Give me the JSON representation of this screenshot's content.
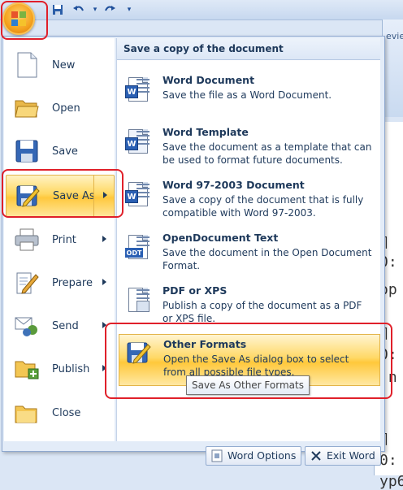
{
  "window": {
    "ribbon_tab_fragment": "evie"
  },
  "document": {
    "lines": [
      "¶",
      "0:",
      "op",
      "¶",
      "0:",
      "·n",
      "¶",
      "0:",
      "yp6"
    ]
  },
  "menu": {
    "left_items": [
      {
        "label": "New",
        "icon": "new-document-icon"
      },
      {
        "label": "Open",
        "icon": "open-folder-icon"
      },
      {
        "label": "Save",
        "icon": "save-disk-icon"
      },
      {
        "label": "Save As",
        "icon": "save-as-icon",
        "active": true,
        "has_submenu": true
      },
      {
        "label": "Print",
        "icon": "printer-icon",
        "has_submenu": true
      },
      {
        "label": "Prepare",
        "icon": "prepare-icon",
        "has_submenu": true
      },
      {
        "label": "Send",
        "icon": "send-icon",
        "has_submenu": true
      },
      {
        "label": "Publish",
        "icon": "publish-icon",
        "has_submenu": true
      },
      {
        "label": "Close",
        "icon": "close-folder-icon"
      }
    ],
    "submenu": {
      "heading": "Save a copy of the document",
      "options": [
        {
          "title": "Word Document",
          "description": "Save the file as a Word Document.",
          "icon": "word-document-icon"
        },
        {
          "title": "Word Template",
          "description": "Save the document as a template that can be used to format future documents.",
          "icon": "word-template-icon"
        },
        {
          "title": "Word 97-2003 Document",
          "description": "Save a copy of the document that is fully compatible with Word 97-2003.",
          "icon": "word-97-2003-icon"
        },
        {
          "title": "OpenDocument Text",
          "description": "Save the document in the Open Document Format.",
          "icon": "odt-document-icon"
        },
        {
          "title": "PDF or XPS",
          "description": "Publish a copy of the document as a PDF or XPS file.",
          "icon": "pdf-xps-icon"
        },
        {
          "title": "Other Formats",
          "description": "Open the Save As dialog box to select from all possible file types.",
          "icon": "other-formats-icon",
          "active": true
        }
      ]
    },
    "footer": {
      "word_options": "Word Options",
      "exit_word": "Exit Word"
    }
  },
  "tooltip": "Save As Other Formats",
  "colors": {
    "accent_highlight": "#ffc83d",
    "annotation_red": "#e0202a",
    "text": "#1e395b"
  }
}
